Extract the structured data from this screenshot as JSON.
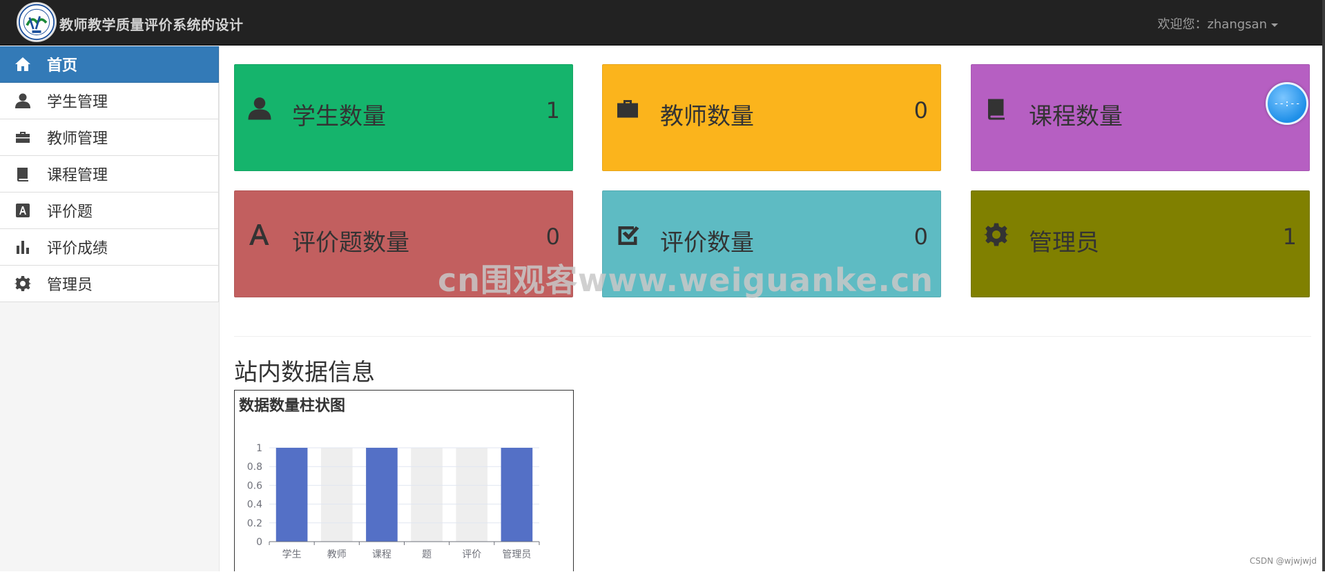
{
  "header": {
    "brand": "教师教学质量评价系统的设计",
    "user_label": "欢迎您：zhangsan"
  },
  "sidebar": {
    "items": [
      {
        "label": "首页",
        "icon": "home-icon",
        "active": true
      },
      {
        "label": "学生管理",
        "icon": "user-icon"
      },
      {
        "label": "教师管理",
        "icon": "briefcase-icon"
      },
      {
        "label": "课程管理",
        "icon": "book-icon"
      },
      {
        "label": "评价题",
        "icon": "font-icon"
      },
      {
        "label": "评价成绩",
        "icon": "stats-icon"
      },
      {
        "label": "管理员",
        "icon": "cog-icon"
      }
    ]
  },
  "cards": [
    {
      "title": "学生数量",
      "value": "1",
      "color": "#15b46c",
      "icon": "user-icon"
    },
    {
      "title": "教师数量",
      "value": "0",
      "color": "#fbb41c",
      "icon": "briefcase-icon"
    },
    {
      "title": "课程数量",
      "value": "",
      "color": "#b65fc2",
      "icon": "book-icon"
    },
    {
      "title": "评价题数量",
      "value": "0",
      "color": "#c25f5f",
      "icon": "font-icon"
    },
    {
      "title": "评价数量",
      "value": "0",
      "color": "#5ebbc3",
      "icon": "check-icon"
    },
    {
      "title": "管理员",
      "value": "1",
      "color": "#808000",
      "icon": "cog-icon"
    }
  ],
  "section": {
    "title": "站内数据信息"
  },
  "chart_data": {
    "type": "bar",
    "title": "数据数量柱状图",
    "categories": [
      "学生",
      "教师",
      "课程",
      "题",
      "评价",
      "管理员"
    ],
    "values": [
      1,
      0,
      1,
      0,
      0,
      1
    ],
    "yticks": [
      "0",
      "0.2",
      "0.4",
      "0.6",
      "0.8",
      "1"
    ],
    "ylim": [
      0,
      1
    ],
    "bar_color": "#5470c6",
    "background_bar_color": "#eeeeee"
  },
  "clock": {
    "text": "--:--"
  },
  "watermark": "cn围观客www.weiguanke.cn",
  "credit": "CSDN @wjwjwjd"
}
